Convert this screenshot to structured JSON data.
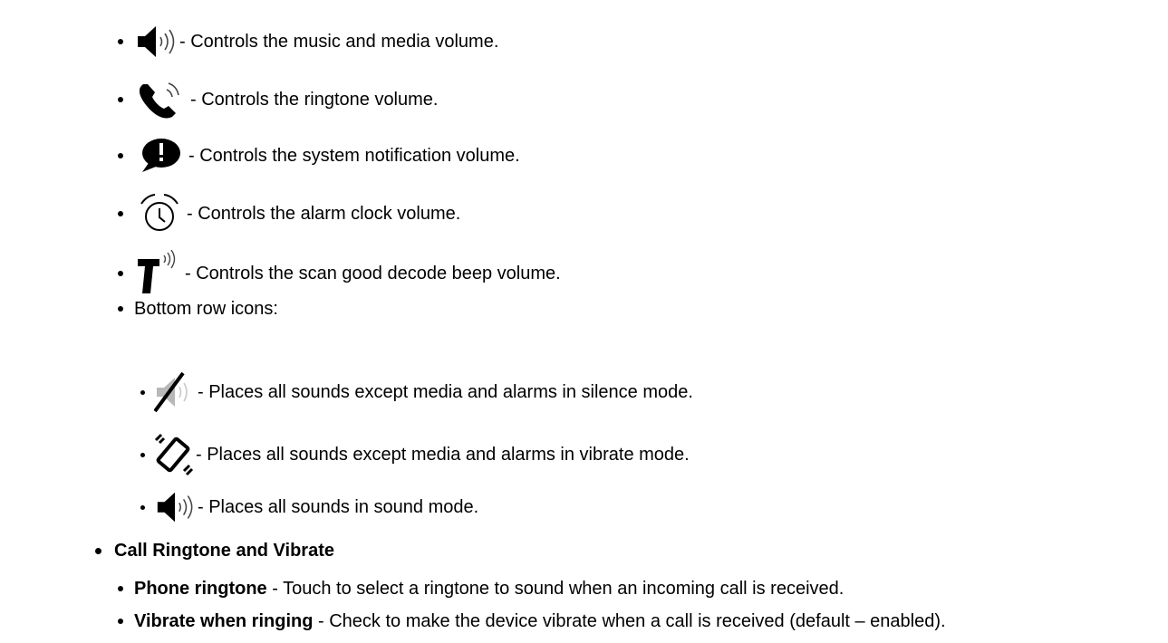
{
  "volume_icons": [
    {
      "icon": "speaker-volume-icon",
      "text": "- Controls the music and media volume."
    },
    {
      "icon": "phone-ringing-icon",
      "text": "- Controls the ringtone volume."
    },
    {
      "icon": "notification-bubble-icon",
      "text": "- Controls the system notification volume."
    },
    {
      "icon": "alarm-clock-icon",
      "text": "- Controls the alarm clock volume."
    },
    {
      "icon": "scanner-beep-icon",
      "text": "- Controls the scan good decode beep volume."
    }
  ],
  "bottom_row": {
    "label": "Bottom row icons:",
    "items": [
      {
        "icon": "speaker-muted-icon",
        "text": "- Places all sounds except media and alarms in silence mode."
      },
      {
        "icon": "vibrate-phone-icon",
        "text": "- Places all sounds except media and alarms in vibrate mode."
      },
      {
        "icon": "speaker-volume-icon",
        "text": "- Places all sounds in sound mode."
      }
    ]
  },
  "call_section": {
    "title": "Call Ringtone and Vibrate",
    "items": [
      {
        "term": "Phone ringtone",
        "text": " - Touch to select a ringtone to sound when an incoming call is received."
      },
      {
        "term": "Vibrate when ringing",
        "text": " - Check to make the device vibrate when a call is received (default – enabled)."
      }
    ]
  }
}
